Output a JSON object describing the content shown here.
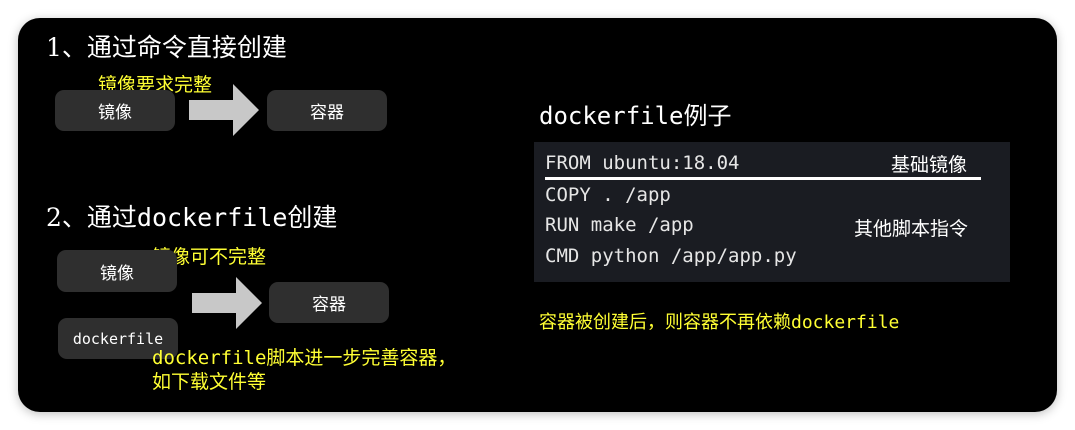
{
  "method1": {
    "heading": "1、通过命令直接创建",
    "note": "镜像要求完整",
    "source_box": "镜像",
    "target_box": "容器"
  },
  "method2": {
    "heading_prefix": "2、通过",
    "heading_mono": "dockerfile",
    "heading_suffix": "创建",
    "note": "镜像可不完整",
    "source_box_image": "镜像",
    "source_box_dockerfile": "dockerfile",
    "target_box": "容器",
    "caption_line1_mono": "dockerfile",
    "caption_line1_rest": "脚本进一步完善容器，",
    "caption_line2": "如下载文件等"
  },
  "example": {
    "title_mono": "dockerfile",
    "title_rest": "例子",
    "code_lines": [
      "FROM ubuntu:18.04",
      "COPY . /app",
      "RUN make /app",
      "CMD python /app/app.py"
    ],
    "note_base_image": "基础镜像",
    "note_other_scripts": "其他脚本指令",
    "footer_prefix": "容器被创建后，则容器不再依赖",
    "footer_mono": "dockerfile"
  },
  "colors": {
    "background": "#000000",
    "note_yellow": "#ffff33",
    "box_gray": "#2f2f2f",
    "arrow_gray": "#c8c8c8",
    "code_panel": "#1a1c22"
  }
}
